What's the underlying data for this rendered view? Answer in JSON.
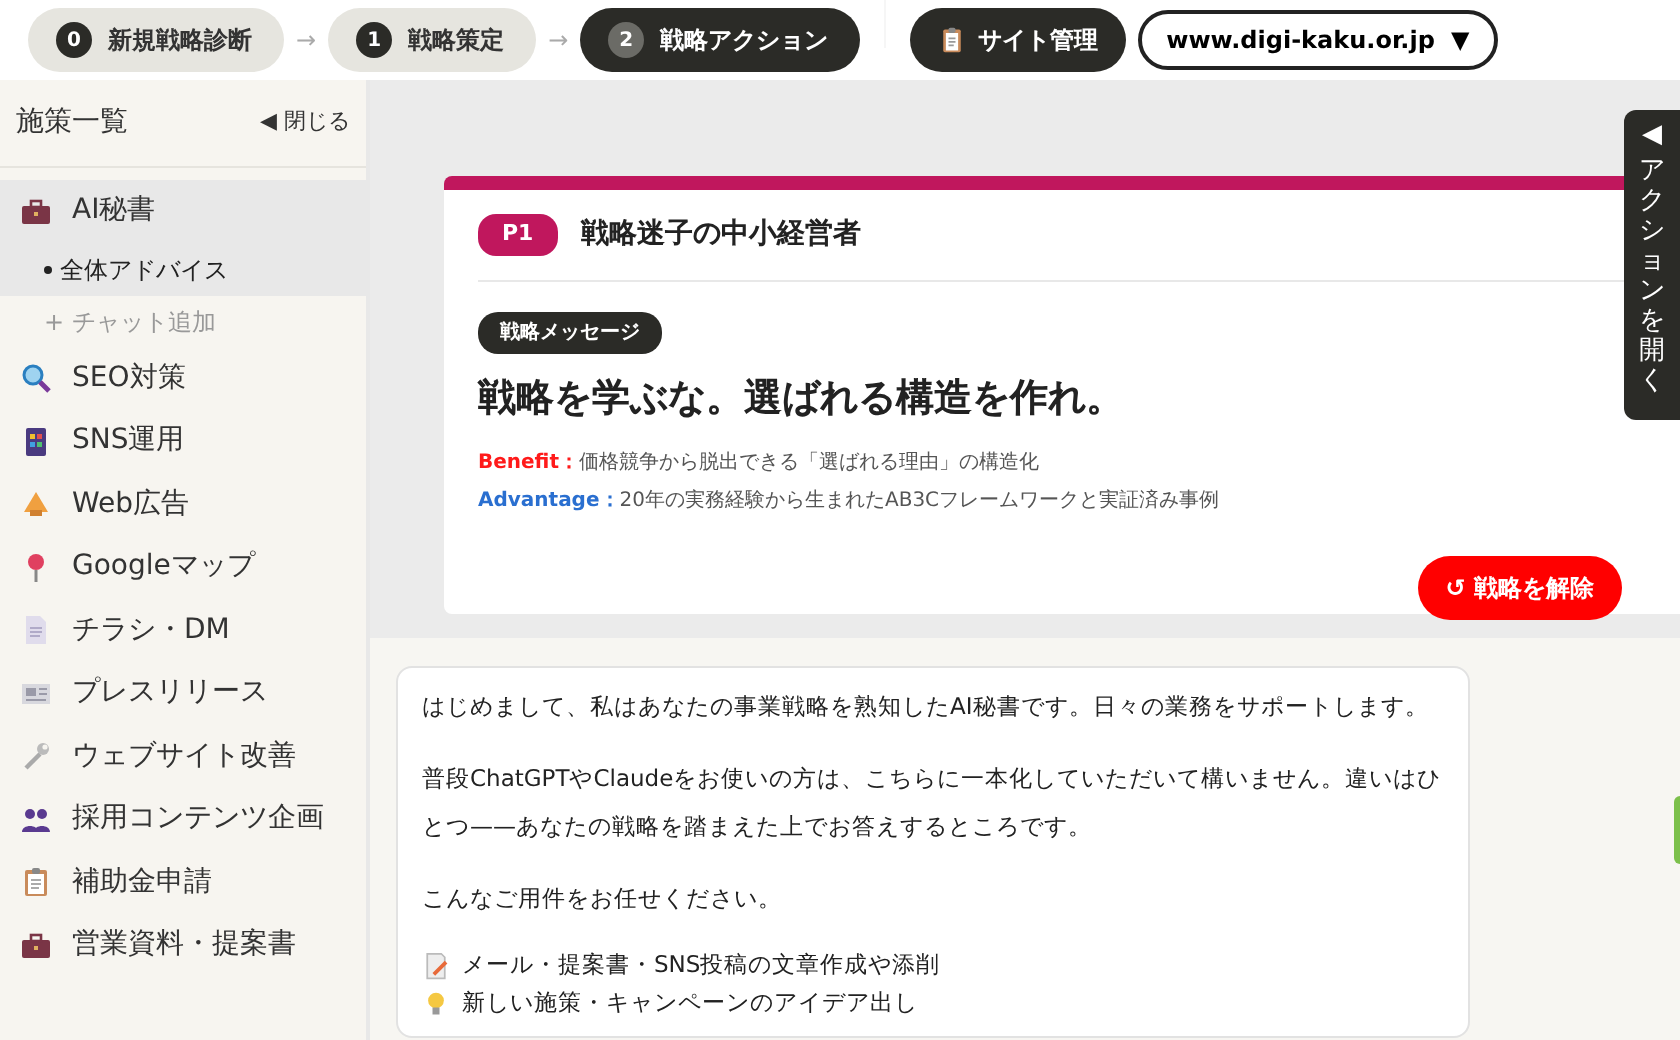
{
  "steps": [
    {
      "number": "0",
      "label": "新規戦略診断",
      "selected": false
    },
    {
      "number": "1",
      "label": "戦略策定",
      "selected": false
    },
    {
      "number": "2",
      "label": "戦略アクション",
      "selected": true
    }
  ],
  "step_separators": [
    "→",
    "→"
  ],
  "site_button": {
    "label": "サイト管理"
  },
  "domain_select": {
    "value": "www.digi-kaku.or.jp",
    "caret": "▼"
  },
  "sidebar": {
    "title": "施策一覧",
    "close": {
      "arrow": "◀",
      "label": "閉じる"
    },
    "items": [
      {
        "label": "AI秘書",
        "selected": true,
        "children": [
          {
            "label": "全体アドバイス",
            "selected": true
          }
        ],
        "add_label": "+ チャット追加"
      },
      {
        "label": "SEO対策",
        "selected": false
      },
      {
        "label": "SNS運用",
        "selected": false
      },
      {
        "label": "Web広告",
        "selected": false
      },
      {
        "label": "Googleマップ",
        "selected": false
      },
      {
        "label": "チラシ・DM",
        "selected": false
      },
      {
        "label": "プレスリリース",
        "selected": false
      },
      {
        "label": "ウェブサイト改善",
        "selected": false
      },
      {
        "label": "採用コンテンツ企画",
        "selected": false
      },
      {
        "label": "補助金申請",
        "selected": false
      },
      {
        "label": "営業資料・提案書",
        "selected": false
      }
    ]
  },
  "strategy_card": {
    "badge": "P1",
    "persona": "戦略迷子の中小経営者",
    "tag": "戦略メッセージ",
    "headline": "戦略を学ぶな。選ばれる構造を作れ。",
    "points": [
      {
        "kind": "benefit",
        "label": "Benefit：",
        "text": "価格競争から脱出できる「選ばれる理由」の構造化"
      },
      {
        "kind": "advantage",
        "label": "Advantage：",
        "text": "20年の実務経験から生まれたAB3Cフレームワークと実証済み事例"
      }
    ],
    "reset_button": {
      "icon": "↺",
      "label": "戦略を解除"
    }
  },
  "action_panel_tab": {
    "arrow": "◀",
    "label": "アクションを開く"
  },
  "chat_message": {
    "paragraphs": [
      "はじめまして、私はあなたの事業戦略を熟知したAI秘書です。日々の業務をサポートします。",
      "普段ChatGPTやClaudeをお使いの方は、こちらに一本化していただいて構いません。違いはひとつ——あなたの戦略を踏まえた上でお答えするところです。",
      "こんなご用件をお任せください。"
    ],
    "list": [
      "メール・提案書・SNS投稿の文章作成や添削",
      "新しい施策・キャンペーンのアイデア出し"
    ]
  }
}
